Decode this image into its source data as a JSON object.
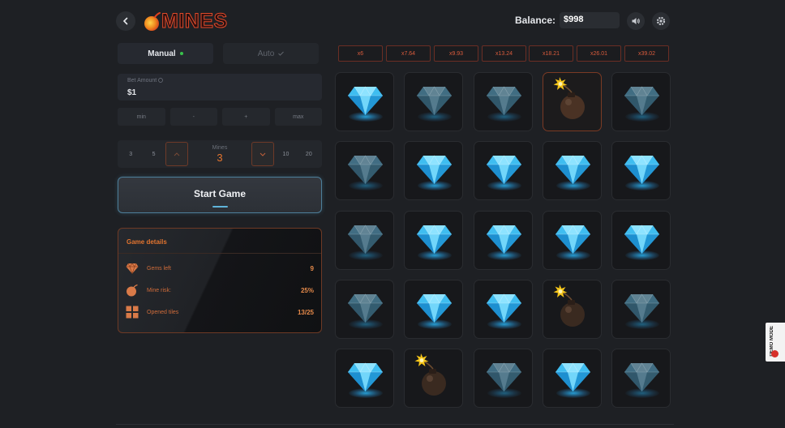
{
  "header": {
    "logo_text": "MINES",
    "balance_label": "Balance:",
    "balance_value": "$998"
  },
  "tabs": [
    {
      "label": "Manual",
      "active": true
    },
    {
      "label": "Auto",
      "active": false
    }
  ],
  "bet": {
    "label": "Bet Amount",
    "value": "$1",
    "buttons": [
      "min",
      "-",
      "+",
      "max"
    ]
  },
  "mines_selector": {
    "left_options": [
      "3",
      "5"
    ],
    "label": "Mines",
    "value": "3",
    "right_options": [
      "10",
      "20"
    ]
  },
  "start_button": {
    "label": "Start Game"
  },
  "game_details": {
    "title": "Game details",
    "rows": [
      {
        "label": "Gems left",
        "value": "9",
        "icon": "gem-icon"
      },
      {
        "label": "Mine risk:",
        "value": "25%",
        "icon": "bomb-icon"
      },
      {
        "label": "Opened tiles",
        "value": "13/25",
        "icon": "tiles-icon"
      }
    ]
  },
  "multipliers": [
    "x6",
    "x7.64",
    "x9.93",
    "x13.24",
    "x18.21",
    "x26.01",
    "x39.02"
  ],
  "grid": {
    "rows": 5,
    "cols": 5,
    "tiles": [
      "gem-bright",
      "gem-dim",
      "gem-dim",
      "bomb-hit",
      "gem-dim",
      "gem-dim",
      "gem-bright",
      "gem-bright",
      "gem-bright",
      "gem-bright",
      "gem-dim",
      "gem-bright",
      "gem-bright",
      "gem-bright",
      "gem-bright",
      "gem-dim",
      "gem-bright",
      "gem-bright",
      "bomb",
      "gem-dim",
      "gem-bright",
      "bomb",
      "gem-dim",
      "gem-bright",
      "gem-dim"
    ]
  },
  "demo_badge": {
    "label": "DEMO MODE"
  },
  "colors": {
    "accent": "#e2742f",
    "gem": "#4fc3f0",
    "background": "#1e2024"
  }
}
